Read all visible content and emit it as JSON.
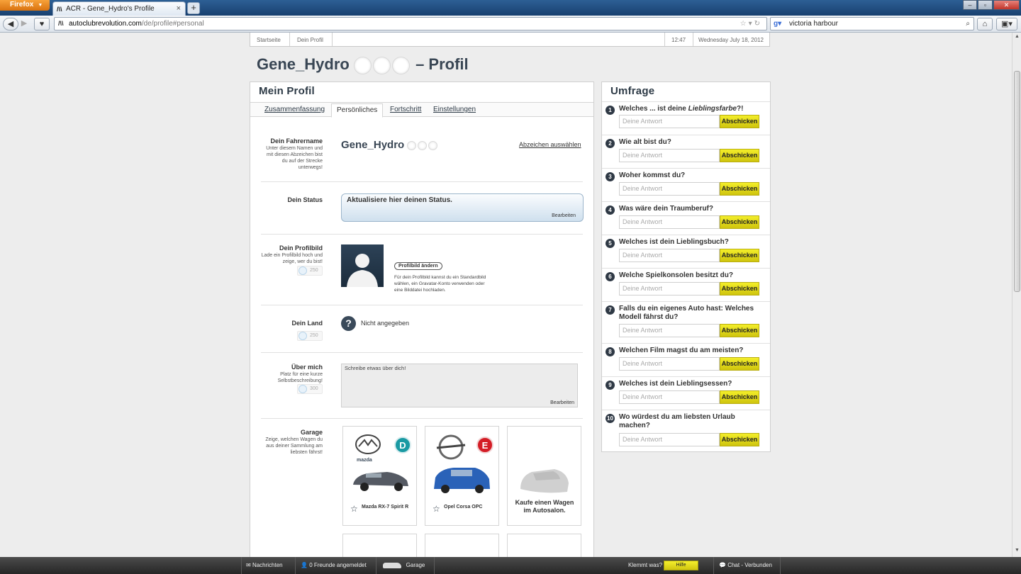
{
  "browser": {
    "app_button": "Firefox",
    "tab_title": "ACR - Gene_Hydro's Profile",
    "url_host": "autoclubrevolution.com",
    "url_path": "/de/profile#personal",
    "search_value": "victoria harbour"
  },
  "breadcrumb": {
    "items": [
      "Startseite",
      "Dein Profil"
    ],
    "time": "12:47",
    "date": "Wednesday July 18, 2012"
  },
  "page": {
    "username": "Gene_Hydro",
    "title_suffix": "– Profil"
  },
  "main": {
    "title": "Mein Profil",
    "tabs": [
      "Zusammenfassung",
      "Persönliches",
      "Fortschritt",
      "Einstellungen"
    ],
    "active_tab": "Persönliches",
    "driver_name": {
      "label": "Dein Fahrername",
      "desc": "Unter diesem Namen und mit diesen Abzeichen bist du auf der Strecke unterwegs!",
      "value": "Gene_Hydro",
      "link": "Abzeichen auswählen"
    },
    "status": {
      "label": "Dein Status",
      "text": "Aktualisiere hier deinen Status.",
      "edit": "Bearbeiten"
    },
    "profile_image": {
      "label": "Dein Profilbild",
      "desc": "Lade ein Profilbild hoch und zeige, wer du bist!",
      "points": "250",
      "button": "Profilbild ändern",
      "help": "Für dein Profilbild kannst du ein Standardbild wählen, ein Gravatar-Konto verwenden oder eine Bilddatei hochladen."
    },
    "country": {
      "label": "Dein Land",
      "points": "250",
      "value": "Nicht angegeben"
    },
    "about": {
      "label": "Über mich",
      "desc": "Platz für eine kurze Selbstbeschreibung!",
      "points": "300",
      "placeholder": "Schreibe etwas über dich!",
      "edit": "Bearbeiten"
    },
    "garage": {
      "label": "Garage",
      "desc": "Zeige, welchen Wagen du aus deiner Sammlung am liebsten fährst!",
      "cars": [
        {
          "name": "Mazda RX-7 Spirit R",
          "brand": "mazda",
          "club": "D",
          "club_color": "#1a9aa3",
          "body_color": "#555a63"
        },
        {
          "name": "Opel Corsa OPC",
          "brand": "opel",
          "club": "E",
          "club_color": "#d41d26",
          "body_color": "#2a62b8"
        }
      ],
      "buy_text": "Kaufe einen Wagen im Autosalon."
    }
  },
  "poll": {
    "title": "Umfrage",
    "placeholder": "Deine Antwort",
    "button": "Abschicken",
    "questions": [
      {
        "num": "1",
        "pre": "Welches ... ist deine ",
        "em": "Lieblingsfarbe",
        "post": "?!"
      },
      {
        "num": "2",
        "text": "Wie alt bist du?"
      },
      {
        "num": "3",
        "text": "Woher kommst du?"
      },
      {
        "num": "4",
        "text": "Was wäre dein Traumberuf?"
      },
      {
        "num": "5",
        "text": "Welches ist dein Lieblingsbuch?"
      },
      {
        "num": "6",
        "text": "Welche Spielkonsolen besitzt du?"
      },
      {
        "num": "7",
        "text": "Falls du ein eigenes Auto hast: Welches Modell fährst du?"
      },
      {
        "num": "8",
        "text": "Welchen Film magst du am meisten?"
      },
      {
        "num": "9",
        "text": "Welches ist dein Lieblingsessen?"
      },
      {
        "num": "10",
        "text": "Wo würdest du am liebsten Urlaub machen?"
      }
    ]
  },
  "footer": {
    "messages": "Nachrichten",
    "friends": "0 Freunde angemeldet",
    "garage": "Garage",
    "trouble": "Klemmt was?",
    "help": "Hilfe",
    "chat": "Chat - Verbunden"
  }
}
